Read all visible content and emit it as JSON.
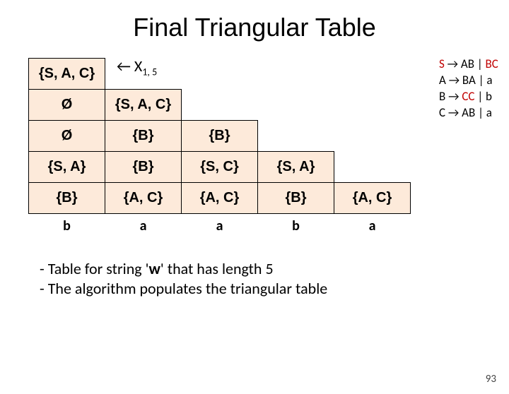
{
  "title": "Final Triangular Table",
  "annotation": {
    "arrow": "←",
    "var": "X",
    "sub": "1, 5"
  },
  "table": {
    "rows": [
      [
        "{S, A, C}",
        "",
        "",
        "",
        ""
      ],
      [
        "Ø",
        "{S, A, C}",
        "",
        "",
        ""
      ],
      [
        "Ø",
        "{B}",
        "{B}",
        "",
        ""
      ],
      [
        "{S, A}",
        "{B}",
        "{S, C}",
        "{S, A}",
        ""
      ],
      [
        "{B}",
        "{A, C}",
        "{A, C}",
        "{B}",
        "{A, C}"
      ]
    ],
    "visible": [
      [
        true,
        false,
        false,
        false,
        false
      ],
      [
        true,
        true,
        false,
        false,
        false
      ],
      [
        true,
        true,
        true,
        false,
        false
      ],
      [
        true,
        true,
        true,
        true,
        false
      ],
      [
        true,
        true,
        true,
        true,
        true
      ]
    ],
    "terminals": [
      "b",
      "a",
      "a",
      "b",
      "a"
    ]
  },
  "grammar": {
    "arrow": "→",
    "sep": "|",
    "lines": [
      {
        "lhs": "S",
        "lhs_red": true,
        "rhs1": "AB",
        "rhs2": "BC",
        "rhs2_red": true
      },
      {
        "lhs": "A",
        "lhs_red": false,
        "rhs1": "BA",
        "rhs2": "a",
        "rhs2_red": false
      },
      {
        "lhs": "B",
        "lhs_red": false,
        "rhs1": "CC",
        "rhs1_red": true,
        "rhs2": "b",
        "rhs2_red": false
      },
      {
        "lhs": "C",
        "lhs_red": false,
        "rhs1": "AB",
        "rhs2": "a",
        "rhs2_red": false
      }
    ]
  },
  "notes": {
    "line1_pre": "- Table for string '",
    "line1_w": "w",
    "line1_post": "' that has  length 5",
    "line2": "- The algorithm populates the triangular table"
  },
  "page": "93",
  "chart_data": {
    "type": "table",
    "description": "CYK triangular parse table for string of length 5",
    "terminals": [
      "b",
      "a",
      "a",
      "b",
      "a"
    ],
    "cells": {
      "X(1,1)": "{B}",
      "X(2,2)": "{A,C}",
      "X(3,3)": "{A,C}",
      "X(4,4)": "{B}",
      "X(5,5)": "{A,C}",
      "X(1,2)": "{S,A}",
      "X(2,3)": "{B}",
      "X(3,4)": "{S,C}",
      "X(4,5)": "{S,A}",
      "X(1,3)": "Ø",
      "X(2,4)": "{B}",
      "X(3,5)": "{B}",
      "X(1,4)": "Ø",
      "X(2,5)": "{S,A,C}",
      "X(1,5)": "{S,A,C}"
    },
    "grammar": [
      "S -> AB | BC",
      "A -> BA | a",
      "B -> CC | b",
      "C -> AB | a"
    ]
  }
}
